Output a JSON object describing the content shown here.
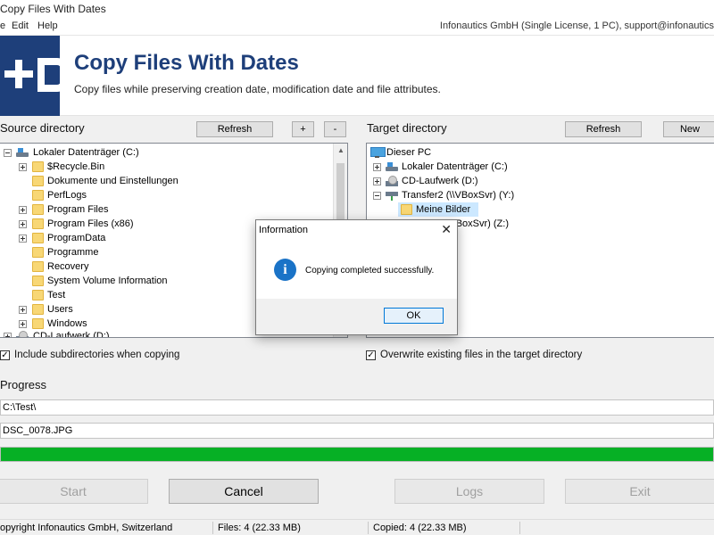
{
  "window": {
    "title": "Copy Files With Dates"
  },
  "menu": {
    "items": [
      "e",
      "Edit",
      "Help"
    ],
    "license": "Infonautics GmbH (Single License, 1 PC), support@infonautics"
  },
  "header": {
    "title": "Copy Files With Dates",
    "subtitle": "Copy files while preserving creation date, modification date and file attributes."
  },
  "source": {
    "label": "Source directory",
    "refresh": "Refresh",
    "add": "+",
    "remove": "-",
    "tree": [
      "Lokaler Datenträger (C:)",
      "$Recycle.Bin",
      "Dokumente und Einstellungen",
      "PerfLogs",
      "Program Files",
      "Program Files (x86)",
      "ProgramData",
      "Programme",
      "Recovery",
      "System Volume Information",
      "Test",
      "Users",
      "Windows",
      "CD-Laufwerk (D:)"
    ]
  },
  "target": {
    "label": "Target directory",
    "refresh": "Refresh",
    "new": "New",
    "tree": [
      "Dieser PC",
      "Lokaler Datenträger (C:)",
      "CD-Laufwerk (D:)",
      "Transfer2 (\\\\VBoxSvr) (Y:)",
      "Meine Bilder",
      "Transfer (\\\\VBoxSvr) (Z:)"
    ]
  },
  "options": {
    "include_subdirs": "Include subdirectories when copying",
    "overwrite": "Overwrite existing files in the target directory"
  },
  "progress": {
    "label": "Progress",
    "current_dir": "C:\\Test\\",
    "current_file": "DSC_0078.JPG",
    "fraction": 1.0
  },
  "buttons": {
    "start": "Start",
    "cancel": "Cancel",
    "logs": "Logs",
    "exit": "Exit"
  },
  "status": {
    "copyright": "opyright Infonautics GmbH, Switzerland",
    "files": "Files: 4 (22.33 MB)",
    "copied": "Copied: 4 (22.33 MB)"
  },
  "dialog": {
    "title": "Information",
    "close": "✕",
    "icon": "i",
    "message": "Copying completed successfully.",
    "ok": "OK"
  },
  "colors": {
    "brand": "#1e3f7a",
    "progress": "#06b025",
    "info": "#1a73c7"
  }
}
